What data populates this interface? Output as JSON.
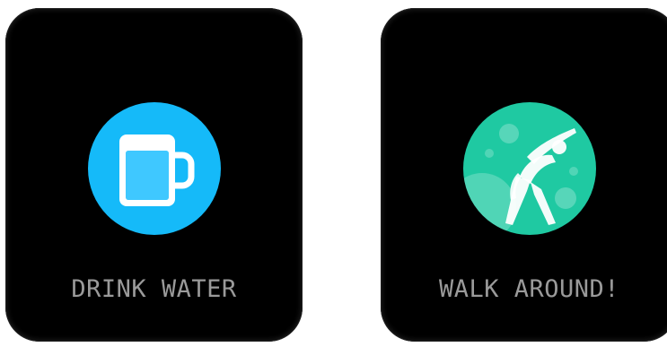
{
  "screens": [
    {
      "label": "DRINK WATER",
      "icon": "water-mug-icon",
      "icon_bg": "#15baf9"
    },
    {
      "label": "WALK AROUND!",
      "icon": "stretching-person-icon",
      "icon_bg": "#1fc9a2"
    }
  ]
}
